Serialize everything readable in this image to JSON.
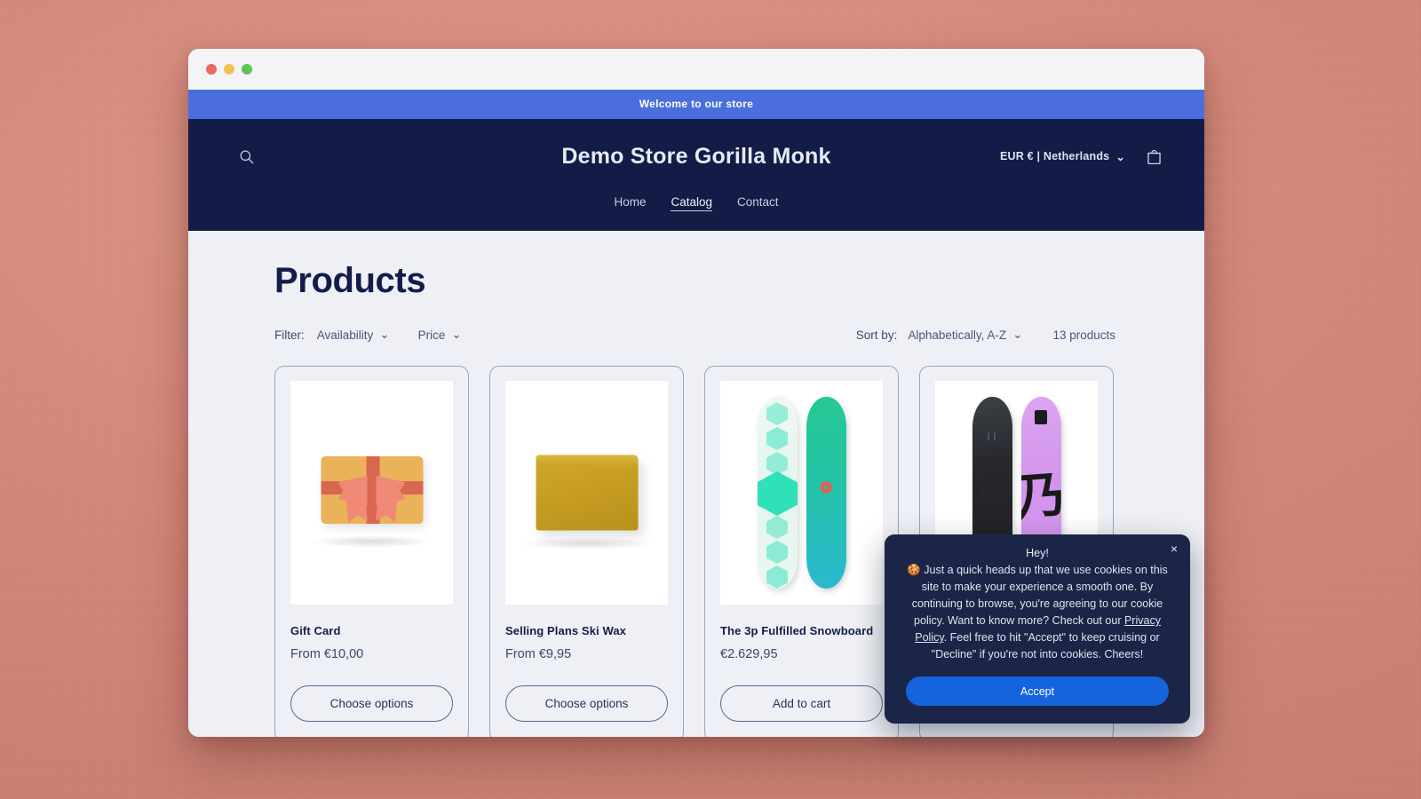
{
  "window": {
    "traffic_lights": [
      "close",
      "minimize",
      "maximize"
    ]
  },
  "announcement": {
    "text": "Welcome to our store"
  },
  "header": {
    "store_title": "Demo Store Gorilla Monk",
    "search_icon": "search-icon",
    "locale": "EUR € | Netherlands",
    "locale_caret": "⌄",
    "cart_icon": "shopping-bag-icon",
    "nav": [
      {
        "label": "Home",
        "active": false
      },
      {
        "label": "Catalog",
        "active": true
      },
      {
        "label": "Contact",
        "active": false
      }
    ]
  },
  "collection": {
    "title": "Products",
    "filter_label": "Filter:",
    "facets": [
      {
        "label": "Availability",
        "caret": "⌄"
      },
      {
        "label": "Price",
        "caret": "⌄"
      }
    ],
    "sort_label": "Sort by:",
    "sort_value": "Alphabetically, A-Z",
    "sort_caret": "⌄",
    "product_count": "13 products"
  },
  "products": [
    {
      "title": "Gift Card",
      "price": "From €10,00",
      "button": "Choose options",
      "image": "gift-card-illustration"
    },
    {
      "title": "Selling Plans Ski Wax",
      "price": "From €9,95",
      "button": "Choose options",
      "image": "ski-wax-bar-photo"
    },
    {
      "title": "The 3p Fulfilled Snowboard",
      "price": "€2.629,95",
      "button": "Add to cart",
      "image": "mint-teal-snowboards-photo"
    },
    {
      "title": "",
      "price": "",
      "button": "",
      "image": "black-purple-snowboards-photo"
    }
  ],
  "cookie_banner": {
    "close_icon": "×",
    "heading": "Hey!",
    "emoji": "🍪",
    "body_part1": " Just a quick heads up that we use cookies on this site to make your experience a smooth one. By continuing to browse, you're agreeing to our cookie policy. Want to know more? Check out our ",
    "link_text": "Privacy Policy",
    "body_part2": ". Feel free to hit \"Accept\" to keep cruising or \"Decline\" if you're not into cookies. Cheers!",
    "accept_label": "Accept"
  },
  "colors": {
    "desktop": "#d5877a",
    "announcement_bg": "#4a6fdc",
    "header_bg": "#121c46",
    "page_bg": "#eef0f5",
    "accent_blue": "#1664dd",
    "card_border": "#9aa3c0",
    "cookie_bg": "#1b2547"
  }
}
